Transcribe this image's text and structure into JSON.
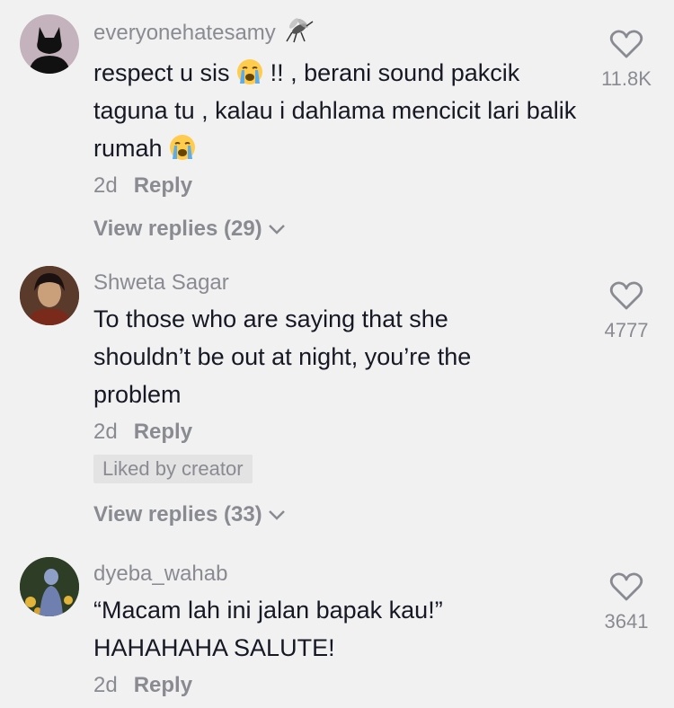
{
  "comments": [
    {
      "username": "everyonehatesamy",
      "text_parts": [
        "respect u sis",
        "!! , berani sound pakcik taguna tu , kalau i dahlama mencicit lari balik rumah"
      ],
      "time": "2d",
      "reply_label": "Reply",
      "view_replies": "View replies (29)",
      "likes": "11.8K",
      "icon": "mosquito-icon"
    },
    {
      "username": "Shweta Sagar",
      "text": "To those who are saying that she shouldn’t be out at night, you’re the problem",
      "time": "2d",
      "reply_label": "Reply",
      "badge": "Liked by creator",
      "view_replies": "View replies (33)",
      "likes": "4777"
    },
    {
      "username": "dyeba_wahab",
      "text_line1": "“Macam lah ini jalan bapak kau!”",
      "text_line2": "HAHAHAHA SALUTE!",
      "time": "2d",
      "reply_label": "Reply",
      "likes": "3641"
    }
  ],
  "colors": {
    "background": "#f1f1f2",
    "secondary_text": "#8a8b91",
    "primary_text": "#161823"
  }
}
